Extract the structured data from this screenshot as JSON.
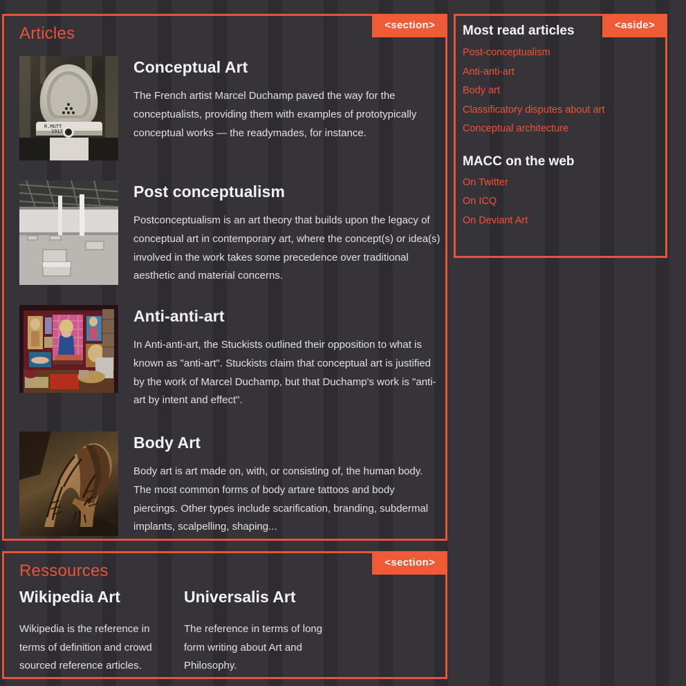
{
  "page": {
    "accent": "#ef5b36",
    "border_color": "#e8533b",
    "link_color": "#ee5338",
    "background": "#2e2c31",
    "text_color": "#e0e0e2"
  },
  "articles_section": {
    "heading": "Articles",
    "tag": "<section>",
    "items": [
      {
        "title": "Conceptual Art",
        "text": "The French artist Marcel Duchamp paved the way for the conceptualists, providing them with examples of prototypically conceptual works — the readymades, for instance.",
        "image_name": "fountain-urinal-photo",
        "image_alt": "Black and white photograph of Marcel Duchamp's Fountain urinal"
      },
      {
        "title": "Post conceptualism",
        "text": "Postconceptualism is an art theory that builds upon the legacy of conceptual art in contemporary art, where the concept(s) or idea(s) involved in the work takes some precedence over traditional aesthetic and material concerns.",
        "image_name": "empty-warehouse-photo",
        "image_alt": "Black and white photograph of an empty warehouse gallery with scattered blocks"
      },
      {
        "title": "Anti-anti-art",
        "text": "In Anti-anti-art, the Stuckists outlined their opposition to what is known as \"anti-art\". Stuckists claim that conceptual art is justified by the work of Marcel Duchamp, but that Duchamp's work is \"anti-art by intent and effect\".",
        "image_name": "stuckist-gallery-room-photo",
        "image_alt": "Colour photograph of a red gallery room hung with paintings"
      },
      {
        "title": "Body Art",
        "text": "Body art is art made on, with, or consisting of, the human body. The most common forms of body artare tattoos and body piercings. Other types include scarification, branding, subdermal implants, scalpelling, shaping...",
        "image_name": "body-paint-figure-photo",
        "image_alt": "Sepia photograph of a body-painted figure bending forward"
      }
    ]
  },
  "aside": {
    "tag": "<aside>",
    "heading_most_read": "Most read articles",
    "most_read_links": [
      "Post-conceptualism",
      "Anti-anti-art",
      "Body art",
      "Classificatory disputes about art",
      "Conceptual architecture"
    ],
    "heading_web": "MACC on the web",
    "web_links": [
      "On Twitter",
      "On ICQ",
      "On Deviant Art"
    ]
  },
  "ressources_section": {
    "heading": "Ressources",
    "tag": "<section>",
    "items": [
      {
        "title": "Wikipedia Art",
        "text": "Wikipedia is the reference in terms of definition and crowd sourced reference articles."
      },
      {
        "title": "Universalis Art",
        "text": "The reference in terms of long form writing about Art and Philosophy."
      }
    ]
  }
}
